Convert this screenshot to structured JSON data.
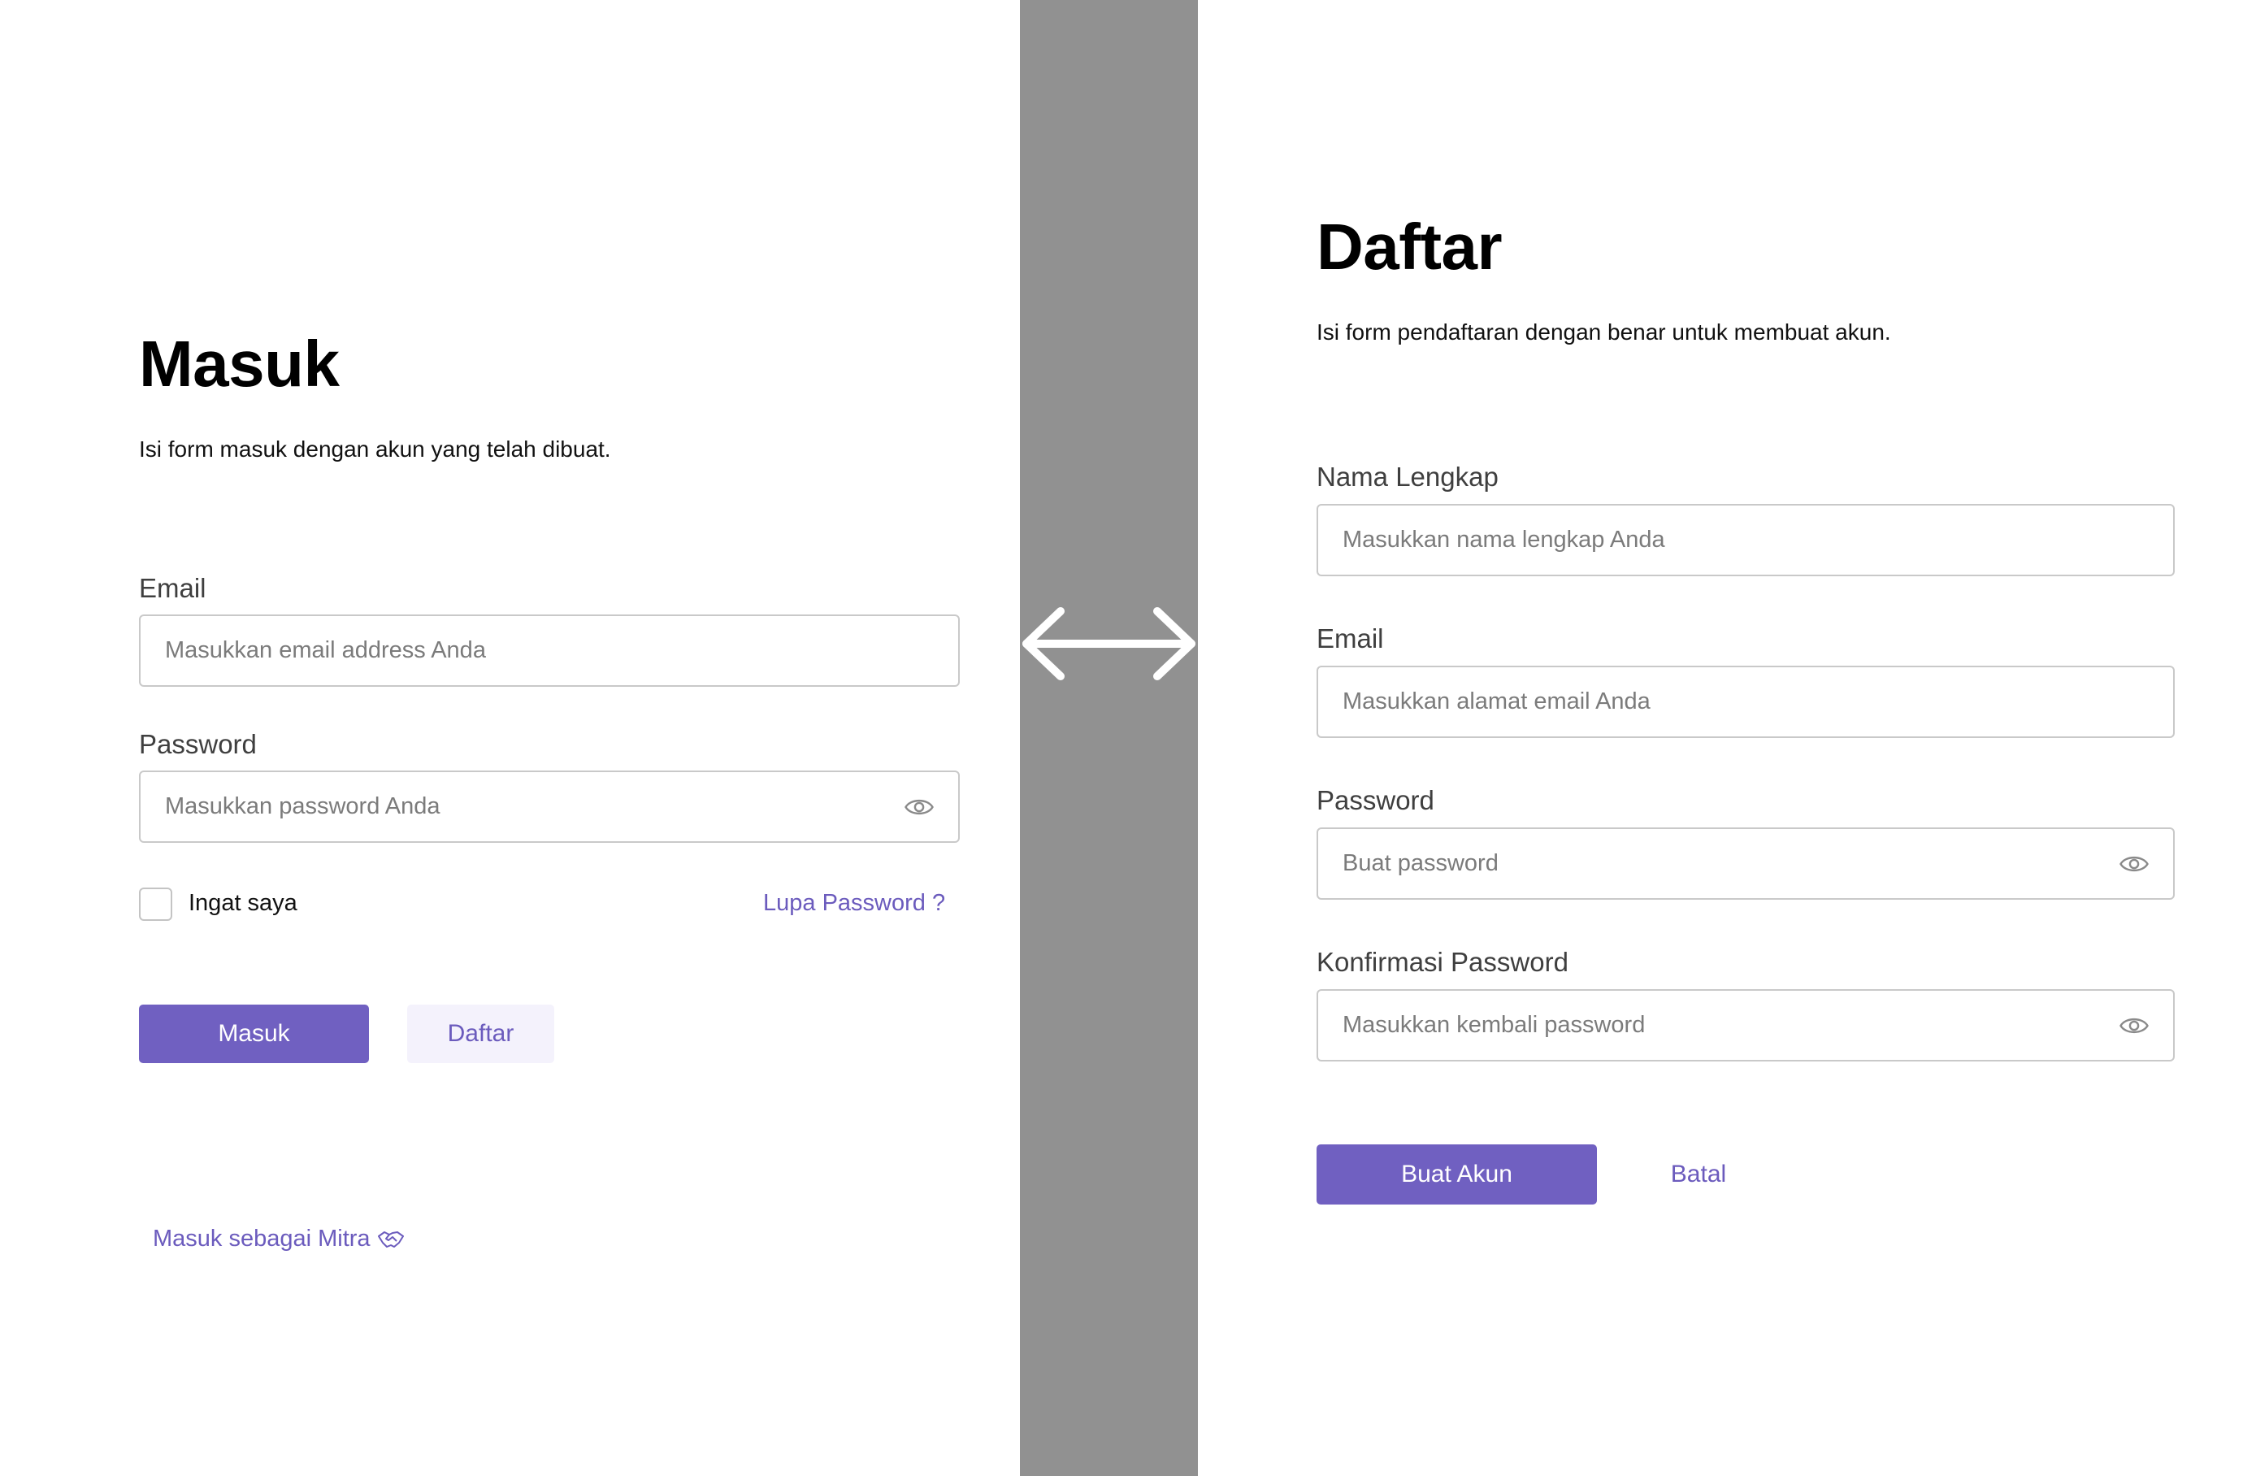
{
  "login": {
    "title": "Masuk",
    "subtitle": "Isi form masuk dengan akun yang telah dibuat.",
    "email_label": "Email",
    "email_placeholder": "Masukkan email address Anda",
    "password_label": "Password",
    "password_placeholder": "Masukkan password Anda",
    "remember_label": "Ingat saya",
    "forgot_link": "Lupa Password ?",
    "submit_label": "Masuk",
    "register_label": "Daftar",
    "partner_link": "Masuk sebagai Mitra"
  },
  "register": {
    "title": "Daftar",
    "subtitle": "Isi form pendaftaran dengan benar untuk membuat akun.",
    "name_label": "Nama Lengkap",
    "name_placeholder": "Masukkan nama lengkap Anda",
    "email_label": "Email",
    "email_placeholder": "Masukkan alamat email Anda",
    "password_label": "Password",
    "password_placeholder": "Buat password",
    "confirm_label": "Konfirmasi Password",
    "confirm_placeholder": "Masukkan kembali password",
    "submit_label": "Buat Akun",
    "cancel_label": "Batal"
  },
  "icons": {
    "divider": "double-arrow-icon",
    "password_toggle": "eye-icon",
    "partner": "handshake-icon"
  },
  "colors": {
    "accent": "#7060c1",
    "accent_soft": "#f4f2fc",
    "divider": "#919191"
  }
}
